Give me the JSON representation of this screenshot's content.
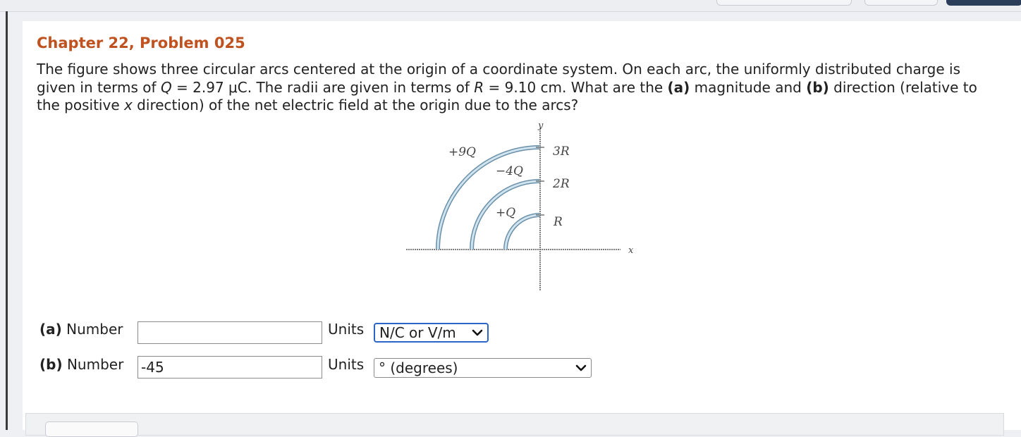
{
  "problem": {
    "title": "Chapter 22, Problem 025",
    "text_1": "The figure shows three circular arcs centered at the origin of a coordinate system. On each arc, the uniformly distributed charge is given in terms of ",
    "Q_symbol": "Q",
    "text_2": " = 2.97 μC. The radii are given in terms of ",
    "R_symbol": "R",
    "text_3": " = 9.10 cm. What are the ",
    "part_a_tag": "(a)",
    "text_4": " magnitude and ",
    "part_b_tag": "(b)",
    "text_5": " direction (relative to the positive ",
    "x_symbol": "x",
    "text_6": " direction) of the net electric field at the origin due to the arcs?"
  },
  "figure": {
    "y_axis_label": "y",
    "x_axis_label": "x",
    "outer_arc_charge": "+9Q",
    "middle_arc_charge": "−4Q",
    "inner_arc_charge": "+Q",
    "outer_radius_label": "3R",
    "middle_radius_label": "2R",
    "inner_radius_label": "R"
  },
  "answers": {
    "a": {
      "tag": "(a)",
      "label": "Number",
      "value": "",
      "units_label": "Units",
      "units_selected": "N/C or V/m"
    },
    "b": {
      "tag": "(b)",
      "label": "Number",
      "value": "-45",
      "units_label": "Units",
      "units_selected": "° (degrees)"
    }
  }
}
